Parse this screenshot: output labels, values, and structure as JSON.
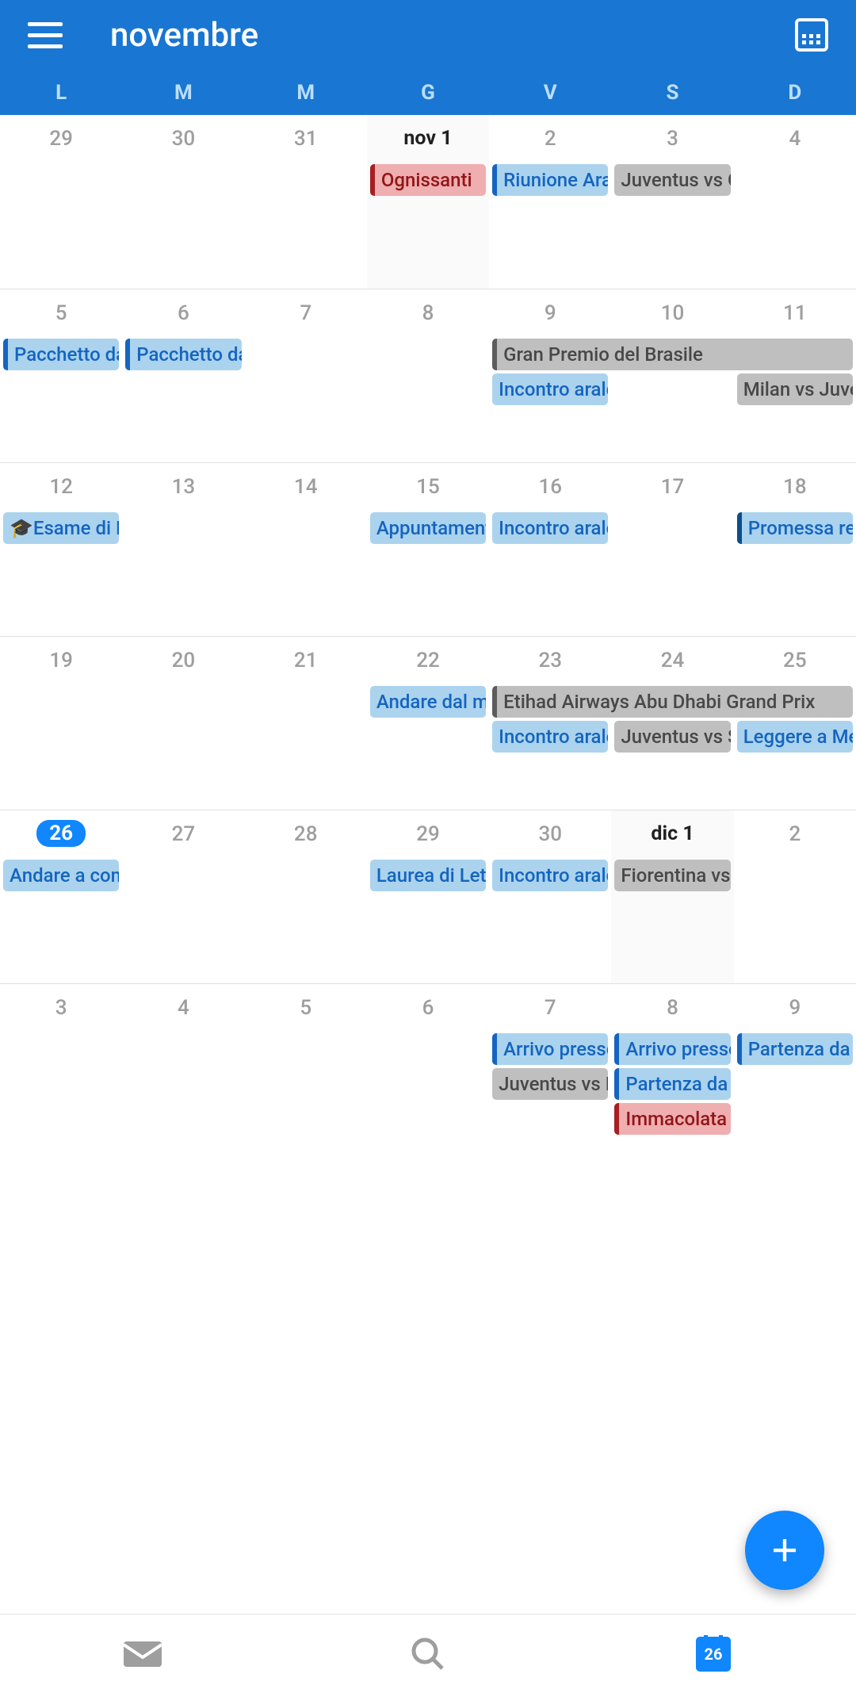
{
  "header": {
    "title": "novembre"
  },
  "weekdays": [
    "L",
    "M",
    "M",
    "G",
    "V",
    "S",
    "D"
  ],
  "today_day": "26",
  "nav": {
    "calendar_badge": "26"
  },
  "weeks": [
    {
      "today_shade_col": 3,
      "days": [
        {
          "num": "29",
          "cls": ""
        },
        {
          "num": "30",
          "cls": ""
        },
        {
          "num": "31",
          "cls": ""
        },
        {
          "num": "nov 1",
          "cls": "month-start"
        },
        {
          "num": "2",
          "cls": ""
        },
        {
          "num": "3",
          "cls": ""
        },
        {
          "num": "4",
          "cls": ""
        }
      ],
      "events": [
        {
          "label": "Ognissanti",
          "row": 0,
          "col": 3,
          "span": 1,
          "style": "color-red"
        },
        {
          "label": "Riunione Aral",
          "row": 0,
          "col": 4,
          "span": 1,
          "style": "color-blue"
        },
        {
          "label": "Juventus vs C",
          "row": 0,
          "col": 5,
          "span": 1,
          "style": "color-gray-thin"
        }
      ]
    },
    {
      "days": [
        {
          "num": "5",
          "cls": ""
        },
        {
          "num": "6",
          "cls": ""
        },
        {
          "num": "7",
          "cls": ""
        },
        {
          "num": "8",
          "cls": ""
        },
        {
          "num": "9",
          "cls": ""
        },
        {
          "num": "10",
          "cls": ""
        },
        {
          "num": "11",
          "cls": ""
        }
      ],
      "events": [
        {
          "label": "Pacchetto da",
          "row": 0,
          "col": 0,
          "span": 1,
          "style": "color-blue"
        },
        {
          "label": "Pacchetto da",
          "row": 0,
          "col": 1,
          "span": 1,
          "style": "color-blue"
        },
        {
          "label": "Gran Premio del Brasile",
          "row": 0,
          "col": 4,
          "span": 3,
          "style": "color-gray"
        },
        {
          "label": "Incontro aralc",
          "row": 1,
          "col": 4,
          "span": 1,
          "style": "color-blue-thin"
        },
        {
          "label": "Milan vs Juve",
          "row": 1,
          "col": 6,
          "span": 1,
          "style": "color-gray-thin"
        }
      ]
    },
    {
      "days": [
        {
          "num": "12",
          "cls": ""
        },
        {
          "num": "13",
          "cls": ""
        },
        {
          "num": "14",
          "cls": ""
        },
        {
          "num": "15",
          "cls": ""
        },
        {
          "num": "16",
          "cls": ""
        },
        {
          "num": "17",
          "cls": ""
        },
        {
          "num": "18",
          "cls": ""
        }
      ],
      "events": [
        {
          "label": "🎓Esame di R",
          "row": 0,
          "col": 0,
          "span": 1,
          "style": "color-blue-thin"
        },
        {
          "label": "Appuntamento",
          "row": 0,
          "col": 3,
          "span": 1,
          "style": "color-blue-thin"
        },
        {
          "label": "Incontro aralc",
          "row": 0,
          "col": 4,
          "span": 1,
          "style": "color-blue-thin"
        },
        {
          "label": "Promessa re",
          "row": 0,
          "col": 6,
          "span": 1,
          "style": "color-blue-accent"
        }
      ]
    },
    {
      "days": [
        {
          "num": "19",
          "cls": ""
        },
        {
          "num": "20",
          "cls": ""
        },
        {
          "num": "21",
          "cls": ""
        },
        {
          "num": "22",
          "cls": ""
        },
        {
          "num": "23",
          "cls": ""
        },
        {
          "num": "24",
          "cls": ""
        },
        {
          "num": "25",
          "cls": ""
        }
      ],
      "events": [
        {
          "label": "Andare dal me",
          "row": 0,
          "col": 3,
          "span": 1,
          "style": "color-blue-thin"
        },
        {
          "label": "Etihad Airways Abu Dhabi Grand Prix",
          "row": 0,
          "col": 4,
          "span": 3,
          "style": "color-gray"
        },
        {
          "label": "Incontro aralc",
          "row": 1,
          "col": 4,
          "span": 1,
          "style": "color-blue-thin"
        },
        {
          "label": "Juventus vs S",
          "row": 1,
          "col": 5,
          "span": 1,
          "style": "color-gray-thin"
        },
        {
          "label": "Leggere a Me",
          "row": 1,
          "col": 6,
          "span": 1,
          "style": "color-blue-thin"
        }
      ]
    },
    {
      "today_shade_col": 5,
      "days": [
        {
          "num": "26",
          "cls": "today"
        },
        {
          "num": "27",
          "cls": ""
        },
        {
          "num": "28",
          "cls": ""
        },
        {
          "num": "29",
          "cls": ""
        },
        {
          "num": "30",
          "cls": ""
        },
        {
          "num": "dic 1",
          "cls": "month-start"
        },
        {
          "num": "2",
          "cls": ""
        }
      ],
      "events": [
        {
          "label": "Andare a com",
          "row": 0,
          "col": 0,
          "span": 1,
          "style": "color-blue-thin"
        },
        {
          "label": "Laurea di Leti",
          "row": 0,
          "col": 3,
          "span": 1,
          "style": "color-blue-thin"
        },
        {
          "label": "Incontro aralc",
          "row": 0,
          "col": 4,
          "span": 1,
          "style": "color-blue-thin"
        },
        {
          "label": "Fiorentina vs ",
          "row": 0,
          "col": 5,
          "span": 1,
          "style": "color-gray-thin"
        }
      ]
    },
    {
      "days": [
        {
          "num": "3",
          "cls": ""
        },
        {
          "num": "4",
          "cls": ""
        },
        {
          "num": "5",
          "cls": ""
        },
        {
          "num": "6",
          "cls": ""
        },
        {
          "num": "7",
          "cls": ""
        },
        {
          "num": "8",
          "cls": ""
        },
        {
          "num": "9",
          "cls": ""
        }
      ],
      "events": [
        {
          "label": "Arrivo presso",
          "row": 0,
          "col": 4,
          "span": 1,
          "style": "color-blue"
        },
        {
          "label": "Arrivo presso",
          "row": 0,
          "col": 5,
          "span": 1,
          "style": "color-blue"
        },
        {
          "label": "Partenza da S",
          "row": 0,
          "col": 6,
          "span": 1,
          "style": "color-blue"
        },
        {
          "label": "Juventus vs Ir",
          "row": 1,
          "col": 4,
          "span": 1,
          "style": "color-gray-thin"
        },
        {
          "label": "Partenza da l",
          "row": 1,
          "col": 5,
          "span": 1,
          "style": "color-blue"
        },
        {
          "label": "Immacolata C",
          "row": 2,
          "col": 5,
          "span": 1,
          "style": "color-red"
        }
      ]
    }
  ]
}
